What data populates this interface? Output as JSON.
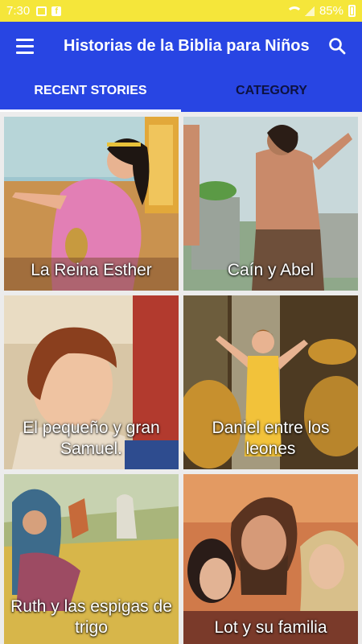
{
  "status_bar": {
    "time": "7:30",
    "battery": "85%",
    "color": "#f5e63a"
  },
  "app_bar": {
    "title": "Historias de la Biblia para Niños",
    "menu_icon": "hamburger-menu-icon",
    "search_icon": "search-icon",
    "color": "#2845e3"
  },
  "tabs": [
    {
      "label": "RECENT STORIES",
      "active": true
    },
    {
      "label": "CATEGORY",
      "active": false
    }
  ],
  "stories": [
    {
      "title": "La Reina Esther"
    },
    {
      "title": "Caín y Abel"
    },
    {
      "title": "El pequeño y gran Samuel."
    },
    {
      "title": "Daniel entre los leones"
    },
    {
      "title": "Ruth y las espigas de trigo"
    },
    {
      "title": "Lot y su familia"
    }
  ]
}
